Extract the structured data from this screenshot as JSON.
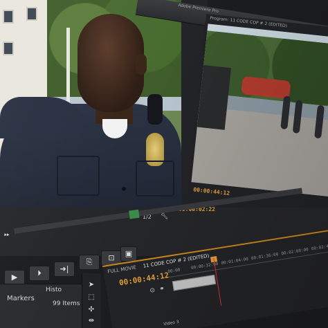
{
  "window": {
    "title": "Adobe Premiere Pro"
  },
  "source_monitor": {
    "zoom": "1/2",
    "timecode": "00:00:02:22"
  },
  "program_monitor": {
    "tab_label": "Program: 11 CODE COP # 2 (EDITED)",
    "timecode": "00:00:44:12"
  },
  "controls": {
    "buttons": [
      {
        "icon": "play-icon",
        "glyph": "▶"
      },
      {
        "icon": "step-forward-icon",
        "glyph": "⏵"
      },
      {
        "icon": "go-to-out-icon",
        "glyph": "➜|"
      },
      {
        "icon": "insert-icon",
        "glyph": "⎘"
      },
      {
        "icon": "overwrite-icon",
        "glyph": "⊡"
      },
      {
        "icon": "export-frame-icon",
        "glyph": "▣"
      }
    ]
  },
  "project_panel": {
    "tabs": [
      "Markers",
      "Histo"
    ],
    "items_count": "99 Items"
  },
  "timeline": {
    "tabs": [
      "FULL MOVIE",
      "11 CODE COP # 2 (EDITED)"
    ],
    "timecode": "00:00:44:12",
    "ruler_marks": [
      "00:00",
      "00:00:32:00",
      "00:01:04:00",
      "00:01:36:00",
      "00:02:08:00",
      "00:02:40:00",
      "00:03:12:00"
    ],
    "track_label": "Video 3"
  },
  "colors": {
    "accent_orange": "#e6a23c",
    "playhead_red": "#dd3333",
    "panel_dark": "#232427"
  }
}
